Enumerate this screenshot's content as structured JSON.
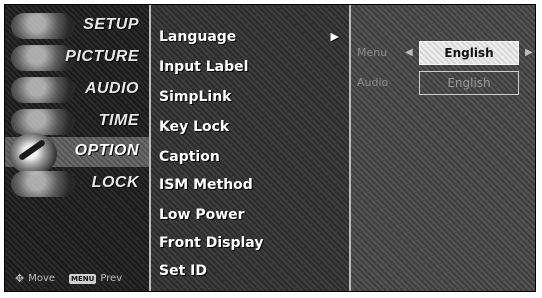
{
  "categories": [
    {
      "label": "SETUP",
      "icon": "setup-disc-icon",
      "selected": false
    },
    {
      "label": "PICTURE",
      "icon": "picture-disc-icon",
      "selected": false
    },
    {
      "label": "AUDIO",
      "icon": "audio-disc-icon",
      "selected": false
    },
    {
      "label": "TIME",
      "icon": "time-disc-icon",
      "selected": false
    },
    {
      "label": "OPTION",
      "icon": "option-disc-icon",
      "selected": true
    },
    {
      "label": "LOCK",
      "icon": "lock-disc-icon",
      "selected": false
    }
  ],
  "footer": {
    "move_label": "Move",
    "menu_key_label": "MENU",
    "prev_label": "Prev"
  },
  "menu": {
    "items": [
      {
        "label": "Language",
        "has_submenu": true
      },
      {
        "label": "Input Label"
      },
      {
        "label": "SimpLink"
      },
      {
        "label": "Key Lock"
      },
      {
        "label": "Caption"
      },
      {
        "label": "ISM Method"
      },
      {
        "label": "Low Power"
      },
      {
        "label": "Front Display"
      },
      {
        "label": "Set ID"
      }
    ],
    "active_index": 0,
    "arrow": "▶"
  },
  "submenu": {
    "rows": [
      {
        "label": "Menu",
        "value": "English",
        "focused": true
      },
      {
        "label": "Audio",
        "value": "English",
        "focused": false
      }
    ],
    "left_arrow": "◀",
    "right_arrow": "▶"
  }
}
